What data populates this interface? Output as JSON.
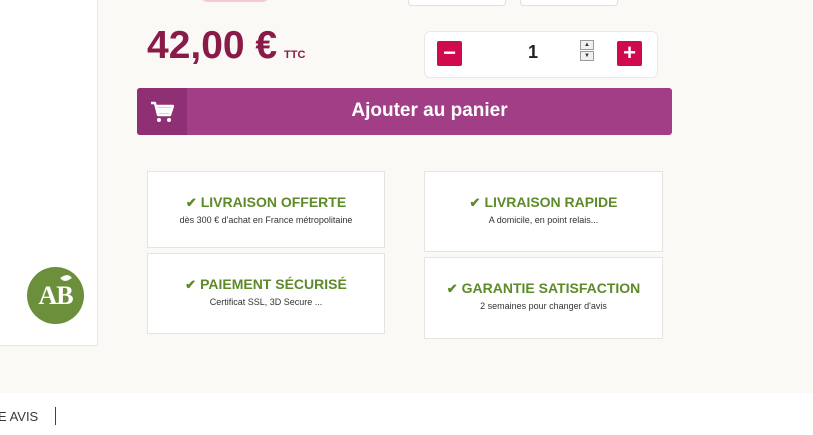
{
  "product": {
    "price": "42,00 €",
    "price_suffix": "TTC"
  },
  "quantity": {
    "value": "1",
    "decrease_label": "−",
    "increase_label": "+",
    "spin_up": "▲",
    "spin_down": "▼"
  },
  "cart": {
    "add_label": "Ajouter au panier",
    "icon": "cart-icon"
  },
  "badge": {
    "logo_text": "AB"
  },
  "features": [
    {
      "check": "✔",
      "title": "LIVRAISON OFFERTE",
      "subtitle": "dès 300 € d'achat en France métropolitaine"
    },
    {
      "check": "✔",
      "title": "LIVRAISON RAPIDE",
      "subtitle": "A domicile, en point relais..."
    },
    {
      "check": "✔",
      "title": "PAIEMENT SÉCURISÉ",
      "subtitle": "Certificat SSL, 3D Secure ..."
    },
    {
      "check": "✔",
      "title": "GARANTIE SATISFACTION",
      "subtitle": "2 semaines pour changer d'avis"
    }
  ],
  "footer": {
    "tab_label": "E AVIS"
  },
  "colors": {
    "price": "#8a1a48",
    "button": "#a23e86",
    "qty_button": "#cf0a4e",
    "feature_green": "#5e8a2a",
    "background": "#faf9f5"
  }
}
